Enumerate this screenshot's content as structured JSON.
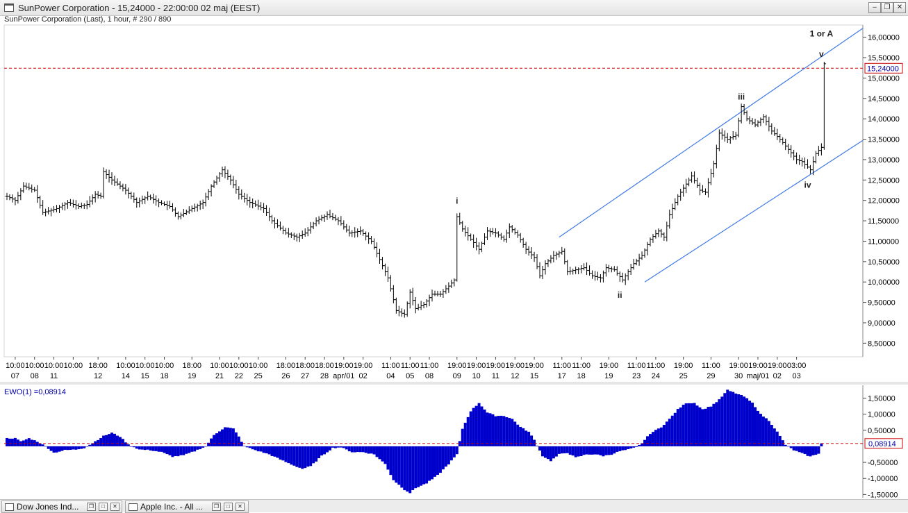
{
  "window": {
    "title": "SunPower Corporation  - 15,24000 - 22:00:00  02 maj (EEST)",
    "subtitle": "SunPower Corporation  (Last), 1 hour, # 290 / 890",
    "buttons": [
      "–",
      "❐",
      "✕"
    ]
  },
  "colors": {
    "price": "#000000",
    "channel": "#3c78e6",
    "last_line": "#cc0000",
    "histogram": "#0000cc",
    "axis_text": "#000000",
    "label_text": "#0000aa"
  },
  "chart_data": [
    {
      "type": "ohlc",
      "interval": "1 hour",
      "ylim": [
        8.2,
        16.3
      ],
      "y_ticks": [
        "16,00000",
        "15,50000",
        "15,00000",
        "14,50000",
        "14,00000",
        "13,50000",
        "13,00000",
        "12,50000",
        "12,00000",
        "11,50000",
        "11,00000",
        "10,50000",
        "10,00000",
        "9,50000",
        "9,00000",
        "8,50000"
      ],
      "y_tick_values": [
        16.0,
        15.5,
        15.0,
        14.5,
        14.0,
        13.5,
        13.0,
        12.5,
        12.0,
        11.5,
        11.0,
        10.5,
        10.0,
        9.5,
        9.0,
        8.5
      ],
      "last_price": 15.24,
      "last_price_label": "15,24000",
      "x_ticks": [
        {
          "i": 3,
          "time": "10:00",
          "date": "07"
        },
        {
          "i": 10,
          "time": "10:00",
          "date": "08"
        },
        {
          "i": 17,
          "time": "10:00",
          "date": "11"
        },
        {
          "i": 24,
          "time": "10:00",
          "date": ""
        },
        {
          "i": 33,
          "time": "18:00",
          "date": "12"
        },
        {
          "i": 43,
          "time": "10:00",
          "date": "14"
        },
        {
          "i": 50,
          "time": "10:00",
          "date": "15"
        },
        {
          "i": 57,
          "time": "10:00",
          "date": "18"
        },
        {
          "i": 67,
          "time": "18:00",
          "date": "19"
        },
        {
          "i": 77,
          "time": "10:00",
          "date": "21"
        },
        {
          "i": 84,
          "time": "10:00",
          "date": "22"
        },
        {
          "i": 91,
          "time": "10:00",
          "date": "25"
        },
        {
          "i": 101,
          "time": "18:00",
          "date": "26"
        },
        {
          "i": 108,
          "time": "18:00",
          "date": "27"
        },
        {
          "i": 115,
          "time": "18:00",
          "date": "28"
        },
        {
          "i": 122,
          "time": "19:00",
          "date": "apr/01"
        },
        {
          "i": 129,
          "time": "19:00",
          "date": "02"
        },
        {
          "i": 139,
          "time": "11:00",
          "date": "04"
        },
        {
          "i": 146,
          "time": "11:00",
          "date": "05"
        },
        {
          "i": 153,
          "time": "11:00",
          "date": "08"
        },
        {
          "i": 163,
          "time": "19:00",
          "date": "09"
        },
        {
          "i": 170,
          "time": "19:00",
          "date": "10"
        },
        {
          "i": 177,
          "time": "19:00",
          "date": "11"
        },
        {
          "i": 184,
          "time": "19:00",
          "date": "12"
        },
        {
          "i": 191,
          "time": "19:00",
          "date": "15"
        },
        {
          "i": 201,
          "time": "11:00",
          "date": "17"
        },
        {
          "i": 208,
          "time": "11:00",
          "date": "18"
        },
        {
          "i": 218,
          "time": "19:00",
          "date": "19"
        },
        {
          "i": 228,
          "time": "11:00",
          "date": "23"
        },
        {
          "i": 235,
          "time": "11:00",
          "date": "24"
        },
        {
          "i": 245,
          "time": "19:00",
          "date": "25"
        },
        {
          "i": 255,
          "time": "11:00",
          "date": "29"
        },
        {
          "i": 265,
          "time": "19:00",
          "date": "30"
        },
        {
          "i": 272,
          "time": "19:00",
          "date": "maj/01"
        },
        {
          "i": 279,
          "time": "19:00",
          "date": "02"
        },
        {
          "i": 286,
          "time": "03:00",
          "date": "03"
        }
      ],
      "anchors": [
        [
          0,
          12.1
        ],
        [
          3,
          12.0
        ],
        [
          6,
          12.35
        ],
        [
          10,
          12.25
        ],
        [
          13,
          11.7
        ],
        [
          18,
          11.8
        ],
        [
          22,
          11.95
        ],
        [
          26,
          11.85
        ],
        [
          29,
          11.9
        ],
        [
          32,
          12.15
        ],
        [
          34,
          12.1
        ],
        [
          35,
          12.7
        ],
        [
          38,
          12.5
        ],
        [
          43,
          12.25
        ],
        [
          47,
          11.95
        ],
        [
          51,
          12.1
        ],
        [
          55,
          11.95
        ],
        [
          59,
          11.85
        ],
        [
          62,
          11.6
        ],
        [
          67,
          11.8
        ],
        [
          71,
          11.95
        ],
        [
          74,
          12.35
        ],
        [
          78,
          12.75
        ],
        [
          81,
          12.5
        ],
        [
          84,
          12.15
        ],
        [
          88,
          11.95
        ],
        [
          93,
          11.8
        ],
        [
          96,
          11.5
        ],
        [
          101,
          11.2
        ],
        [
          105,
          11.1
        ],
        [
          108,
          11.2
        ],
        [
          112,
          11.5
        ],
        [
          116,
          11.65
        ],
        [
          120,
          11.5
        ],
        [
          124,
          11.2
        ],
        [
          128,
          11.25
        ],
        [
          132,
          11.0
        ],
        [
          135,
          10.55
        ],
        [
          138,
          10.1
        ],
        [
          141,
          9.3
        ],
        [
          144,
          9.2
        ],
        [
          146,
          9.75
        ],
        [
          148,
          9.35
        ],
        [
          151,
          9.45
        ],
        [
          154,
          9.7
        ],
        [
          157,
          9.7
        ],
        [
          160,
          9.9
        ],
        [
          162,
          10.05
        ],
        [
          163,
          11.6
        ],
        [
          165,
          11.3
        ],
        [
          168,
          11.05
        ],
        [
          171,
          10.8
        ],
        [
          174,
          11.25
        ],
        [
          177,
          11.2
        ],
        [
          180,
          11.05
        ],
        [
          182,
          11.35
        ],
        [
          185,
          11.15
        ],
        [
          188,
          10.8
        ],
        [
          191,
          10.6
        ],
        [
          193,
          10.15
        ],
        [
          195,
          10.45
        ],
        [
          198,
          10.65
        ],
        [
          201,
          10.75
        ],
        [
          203,
          10.25
        ],
        [
          206,
          10.3
        ],
        [
          209,
          10.35
        ],
        [
          212,
          10.15
        ],
        [
          215,
          10.1
        ],
        [
          217,
          10.35
        ],
        [
          220,
          10.3
        ],
        [
          223,
          10.05
        ],
        [
          225,
          10.25
        ],
        [
          227,
          10.45
        ],
        [
          230,
          10.65
        ],
        [
          233,
          11.05
        ],
        [
          236,
          11.25
        ],
        [
          238,
          11.1
        ],
        [
          240,
          11.65
        ],
        [
          243,
          12.1
        ],
        [
          246,
          12.4
        ],
        [
          248,
          12.6
        ],
        [
          251,
          12.25
        ],
        [
          253,
          12.2
        ],
        [
          256,
          12.9
        ],
        [
          258,
          13.65
        ],
        [
          261,
          13.5
        ],
        [
          264,
          13.6
        ],
        [
          266,
          14.3
        ],
        [
          268,
          14.0
        ],
        [
          271,
          13.85
        ],
        [
          274,
          14.05
        ],
        [
          277,
          13.7
        ],
        [
          280,
          13.5
        ],
        [
          283,
          13.25
        ],
        [
          286,
          13.0
        ],
        [
          288,
          12.95
        ],
        [
          291,
          12.75
        ],
        [
          293,
          13.15
        ],
        [
          295,
          13.3
        ],
        [
          296,
          15.35
        ]
      ],
      "annotations": [
        {
          "label": "i",
          "i": 163,
          "value": 11.85,
          "pos": "above"
        },
        {
          "label": "ii",
          "i": 222,
          "value": 9.85,
          "pos": "below"
        },
        {
          "label": "iii",
          "i": 266,
          "value": 14.4,
          "pos": "above"
        },
        {
          "label": "iv",
          "i": 290,
          "value": 12.55,
          "pos": "below"
        },
        {
          "label": "v",
          "i": 295,
          "value": 15.45,
          "pos": "above"
        },
        {
          "label": "1 or A",
          "i": 295,
          "value": 15.95,
          "pos": "above"
        }
      ],
      "channel": {
        "upper": [
          [
            200,
            11.1
          ],
          [
            310,
            16.22
          ]
        ],
        "lower": [
          [
            231,
            10.0
          ],
          [
            310,
            13.47
          ]
        ]
      }
    },
    {
      "type": "histogram",
      "label": "EWO(1) =0,08914",
      "ylim": [
        -1.6,
        1.9
      ],
      "y_ticks": [
        "1,50000",
        "1,00000",
        "0,50000",
        "-0,50000",
        "-1,00000",
        "-1,50000"
      ],
      "y_tick_values": [
        1.5,
        1.0,
        0.5,
        -0.5,
        -1.0,
        -1.5
      ],
      "last_value": 0.08914,
      "last_value_label": "0,08914",
      "anchors": [
        [
          0,
          0.25
        ],
        [
          3,
          0.25
        ],
        [
          5,
          0.15
        ],
        [
          8,
          0.25
        ],
        [
          11,
          0.15
        ],
        [
          14,
          0.0
        ],
        [
          17,
          -0.2
        ],
        [
          21,
          -0.12
        ],
        [
          25,
          -0.1
        ],
        [
          28,
          -0.05
        ],
        [
          31,
          0.1
        ],
        [
          35,
          0.32
        ],
        [
          38,
          0.42
        ],
        [
          41,
          0.3
        ],
        [
          44,
          0.05
        ],
        [
          48,
          -0.1
        ],
        [
          52,
          -0.12
        ],
        [
          56,
          -0.18
        ],
        [
          60,
          -0.32
        ],
        [
          64,
          -0.28
        ],
        [
          68,
          -0.15
        ],
        [
          72,
          0.0
        ],
        [
          75,
          0.35
        ],
        [
          79,
          0.6
        ],
        [
          82,
          0.55
        ],
        [
          84,
          0.3
        ],
        [
          86,
          0.0
        ],
        [
          90,
          -0.12
        ],
        [
          95,
          -0.25
        ],
        [
          100,
          -0.45
        ],
        [
          104,
          -0.6
        ],
        [
          107,
          -0.7
        ],
        [
          110,
          -0.62
        ],
        [
          114,
          -0.3
        ],
        [
          118,
          -0.05
        ],
        [
          121,
          -0.03
        ],
        [
          125,
          -0.18
        ],
        [
          129,
          -0.18
        ],
        [
          133,
          -0.25
        ],
        [
          137,
          -0.55
        ],
        [
          140,
          -1.05
        ],
        [
          144,
          -1.35
        ],
        [
          146,
          -1.45
        ],
        [
          148,
          -1.3
        ],
        [
          152,
          -1.15
        ],
        [
          156,
          -0.9
        ],
        [
          160,
          -0.55
        ],
        [
          163,
          -0.25
        ],
        [
          165,
          0.55
        ],
        [
          168,
          1.1
        ],
        [
          171,
          1.35
        ],
        [
          174,
          1.05
        ],
        [
          177,
          0.95
        ],
        [
          180,
          0.95
        ],
        [
          183,
          0.85
        ],
        [
          186,
          0.6
        ],
        [
          189,
          0.45
        ],
        [
          191,
          0.2
        ],
        [
          194,
          -0.3
        ],
        [
          197,
          -0.45
        ],
        [
          200,
          -0.25
        ],
        [
          203,
          -0.2
        ],
        [
          206,
          -0.35
        ],
        [
          210,
          -0.25
        ],
        [
          213,
          -0.25
        ],
        [
          216,
          -0.3
        ],
        [
          219,
          -0.25
        ],
        [
          222,
          -0.15
        ],
        [
          225,
          -0.1
        ],
        [
          228,
          -0.03
        ],
        [
          230,
          0.1
        ],
        [
          233,
          0.4
        ],
        [
          237,
          0.6
        ],
        [
          240,
          0.85
        ],
        [
          243,
          1.15
        ],
        [
          246,
          1.35
        ],
        [
          249,
          1.35
        ],
        [
          252,
          1.15
        ],
        [
          255,
          1.25
        ],
        [
          258,
          1.45
        ],
        [
          261,
          1.75
        ],
        [
          264,
          1.65
        ],
        [
          267,
          1.55
        ],
        [
          270,
          1.35
        ],
        [
          273,
          1.0
        ],
        [
          276,
          0.8
        ],
        [
          279,
          0.45
        ],
        [
          282,
          0.05
        ],
        [
          285,
          -0.12
        ],
        [
          288,
          -0.22
        ],
        [
          291,
          -0.32
        ],
        [
          294,
          -0.22
        ],
        [
          295,
          0.09
        ]
      ]
    }
  ],
  "tabs": [
    {
      "label": "Dow Jones Ind..."
    },
    {
      "label": "Apple Inc. - All ..."
    }
  ]
}
